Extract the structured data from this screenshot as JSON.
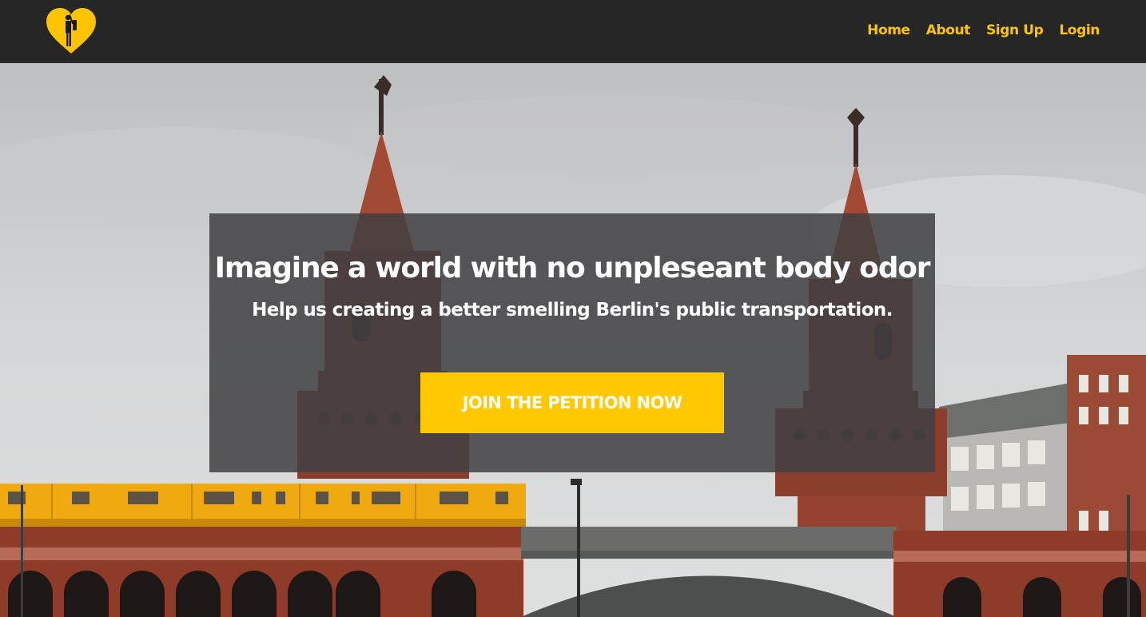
{
  "brand": {
    "logo_icon": "heart-with-person-icon",
    "accent_color": "#ffc400"
  },
  "nav": {
    "items": [
      {
        "label": "Home"
      },
      {
        "label": "About"
      },
      {
        "label": "Sign Up"
      },
      {
        "label": "Login"
      }
    ]
  },
  "hero": {
    "background_scene": "oberbaum-bridge-photo",
    "headline": "Imagine a world with no unpleseant body odor",
    "subline": "Help us creating a better smelling Berlin's public transportation.",
    "cta_label": "JOIN THE PETITION NOW",
    "cta_color": "#ffc800",
    "overlay_color": "#404042"
  }
}
